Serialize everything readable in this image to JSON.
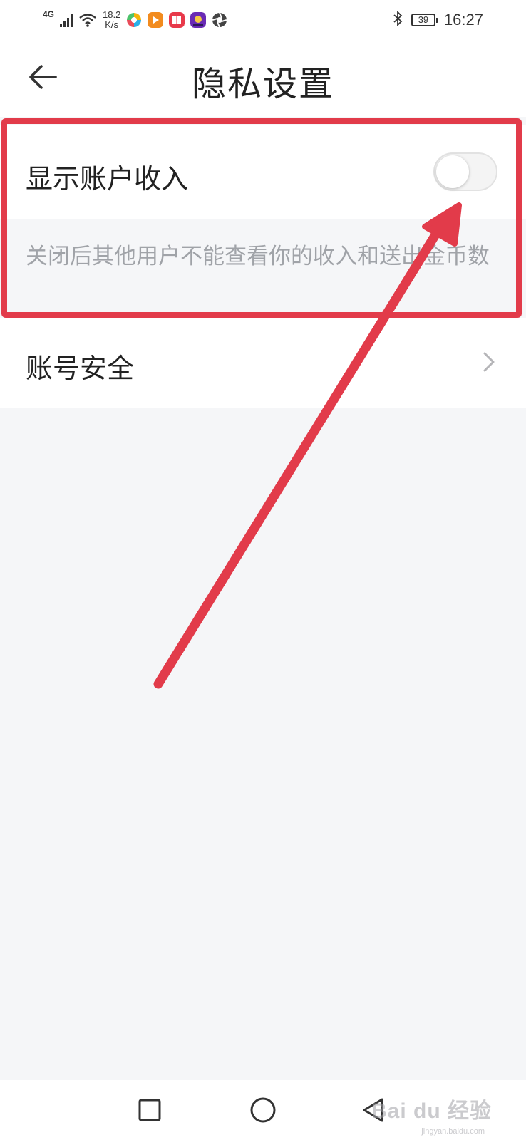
{
  "status_bar": {
    "network": "4G",
    "speed_value": "18.2",
    "speed_unit": "K/s",
    "battery": "39",
    "time": "16:27",
    "icons": [
      "signal-icon",
      "wifi-icon",
      "app-icon-colorful",
      "app-icon-play",
      "app-icon-book",
      "app-icon-game",
      "app-icon-aperture",
      "bluetooth-icon",
      "battery-icon"
    ]
  },
  "header": {
    "title": "隐私设置",
    "back_icon": "arrow-left-icon"
  },
  "settings": {
    "show_income": {
      "label": "显示账户收入",
      "enabled": false,
      "description": "关闭后其他用户不能查看你的收入和送出金币数"
    },
    "account_security": {
      "label": "账号安全",
      "icon": "chevron-right-icon"
    }
  },
  "annotation": {
    "color": "#e23b4a"
  },
  "nav_bar": {
    "icons": [
      "square-icon",
      "circle-icon",
      "triangle-back-icon"
    ]
  },
  "watermark": {
    "text": "Bai du 经验",
    "sub": "jingyan.baidu.com"
  },
  "colors": {
    "accent": "#e23b4a",
    "background": "#f5f6f8",
    "text_primary": "#222222",
    "text_secondary": "#a0a3a8"
  }
}
